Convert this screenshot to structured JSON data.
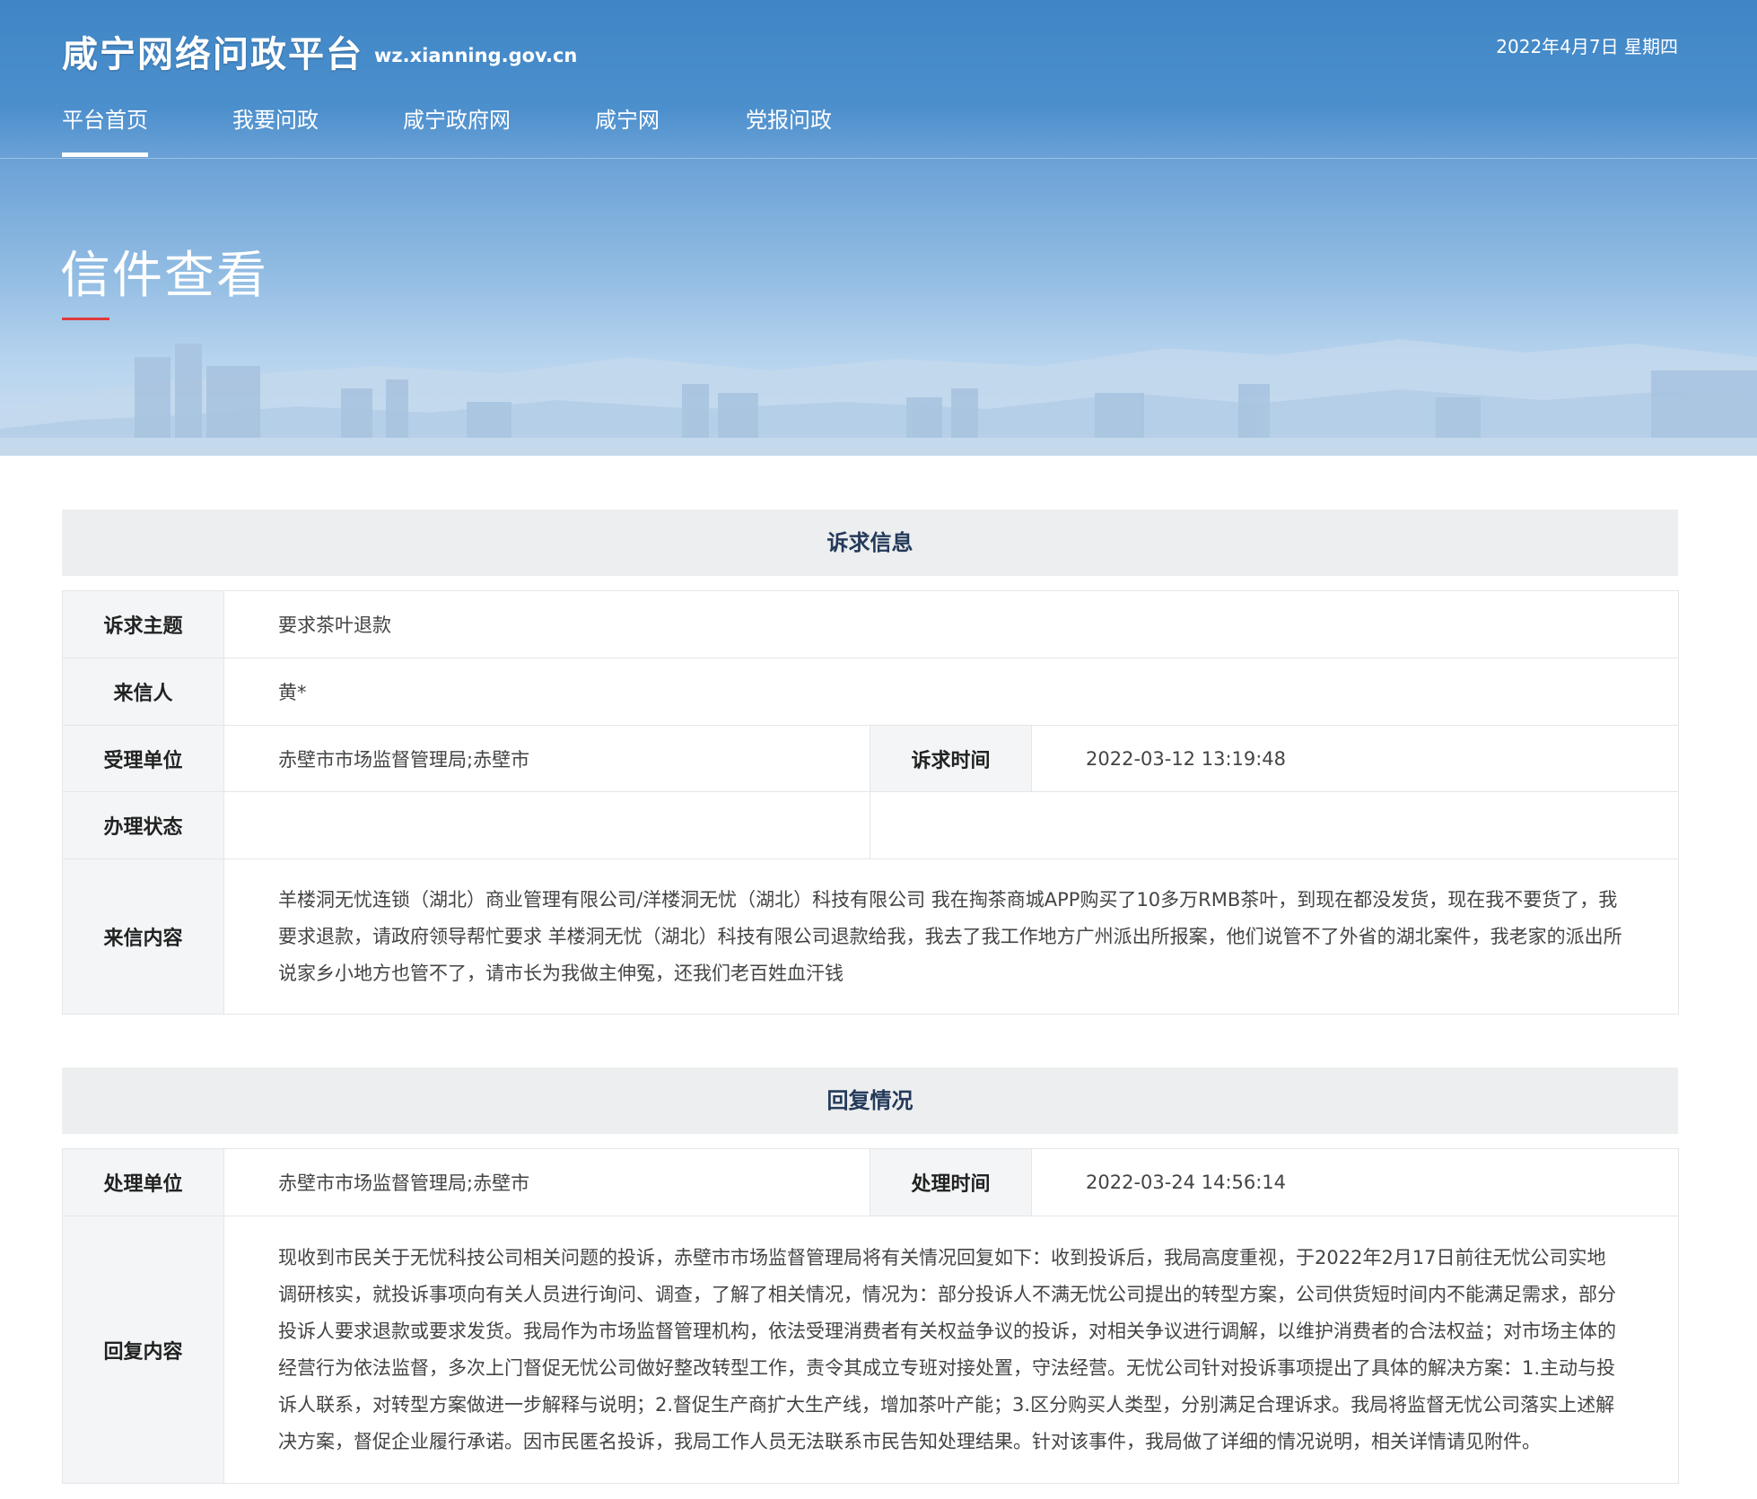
{
  "header": {
    "site_title": "咸宁网络问政平台",
    "site_domain": "wz.xianning.gov.cn",
    "date": "2022年4月7日 星期四"
  },
  "nav": {
    "items": [
      {
        "label": "平台首页",
        "active": true
      },
      {
        "label": "我要问政"
      },
      {
        "label": "咸宁政府网"
      },
      {
        "label": "咸宁网"
      },
      {
        "label": "党报问政"
      }
    ]
  },
  "page": {
    "heading": "信件查看"
  },
  "request": {
    "section_title": "诉求信息",
    "subject_label": "诉求主题",
    "subject": "要求茶叶退款",
    "sender_label": "来信人",
    "sender": "黄*",
    "unit_label": "受理单位",
    "unit": "赤壁市市场监督管理局;赤壁市",
    "time_label": "诉求时间",
    "time": "2022-03-12 13:19:48",
    "status_label": "办理状态",
    "status": "",
    "content_label": "来信内容",
    "content": "羊楼洞无忧连锁（湖北）商业管理有限公司/洋楼洞无忧（湖北）科技有限公司 我在掏茶商城APP购买了10多万RMB茶叶，到现在都没发货，现在我不要货了，我要求退款，请政府领导帮忙要求 羊楼洞无忧（湖北）科技有限公司退款给我，我去了我工作地方广州派出所报案，他们说管不了外省的湖北案件，我老家的派出所说家乡小地方也管不了，请市长为我做主伸冤，还我们老百姓血汗钱"
  },
  "reply": {
    "section_title": "回复情况",
    "unit_label": "处理单位",
    "unit": "赤壁市市场监督管理局;赤壁市",
    "time_label": "处理时间",
    "time": "2022-03-24 14:56:14",
    "content_label": "回复内容",
    "content": "现收到市民关于无忧科技公司相关问题的投诉，赤壁市市场监督管理局将有关情况回复如下：收到投诉后，我局高度重视，于2022年2月17日前往无忧公司实地调研核实，就投诉事项向有关人员进行询问、调查，了解了相关情况，情况为：部分投诉人不满无忧公司提出的转型方案，公司供货短时间内不能满足需求，部分投诉人要求退款或要求发货。我局作为市场监督管理机构，依法受理消费者有关权益争议的投诉，对相关争议进行调解，以维护消费者的合法权益；对市场主体的经营行为依法监督，多次上门督促无忧公司做好整改转型工作，责令其成立专班对接处置，守法经营。无忧公司针对投诉事项提出了具体的解决方案：1.主动与投诉人联系，对转型方案做进一步解释与说明；2.督促生产商扩大生产线，增加茶叶产能；3.区分购买人类型，分别满足合理诉求。我局将监督无忧公司落实上述解决方案，督促企业履行承诺。因市民匿名投诉，我局工作人员无法联系市民告知处理结果。针对该事件，我局做了详细的情况说明，相关详情请见附件。"
  }
}
